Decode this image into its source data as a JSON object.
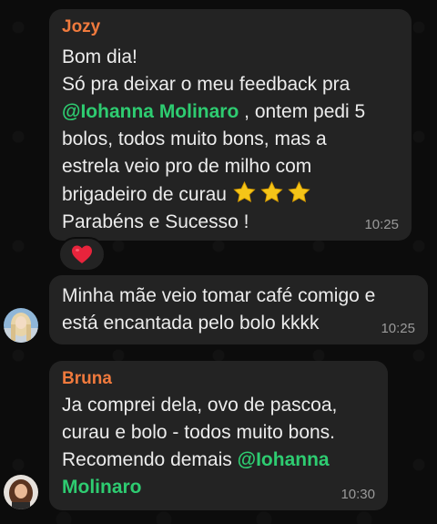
{
  "messages": [
    {
      "sender": "Jozy",
      "lines": {
        "l1": "Bom dia!",
        "l2": "Só pra deixar o meu feedback pra",
        "l3_mention": "@Iohanna Molinaro",
        "l3_rest": " , ontem pedi 5",
        "l4": "bolos, todos muito bons, mas a",
        "l5": "estrela veio pro de milho com",
        "l6": "brigadeiro de curau ",
        "l7": "Parabéns e Sucesso !"
      },
      "time": "10:25",
      "reaction_icon": "red-heart-icon",
      "trailing_icons": [
        "star-icon",
        "star-icon",
        "star-icon"
      ]
    },
    {
      "sender": "",
      "lines": {
        "l1": "Minha mãe veio tomar café comigo e",
        "l2": "está encantada pelo bolo kkkk"
      },
      "time": "10:25"
    },
    {
      "sender": "Bruna",
      "lines": {
        "l1": "Ja comprei dela, ovo de pascoa,",
        "l2": "curau e bolo - todos muito bons.",
        "l3": "Recomendo demais ",
        "l3_mention": "@Iohanna",
        "l4_mention": "Molinaro"
      },
      "time": "10:30"
    }
  ],
  "colors": {
    "background": "#0c0c0c",
    "bubble": "#232323",
    "sender_name": "#f07a3d",
    "mention": "#2ecc71",
    "timestamp": "#9a9a9a",
    "heart": "#e8243c",
    "star": "#f5c518"
  }
}
